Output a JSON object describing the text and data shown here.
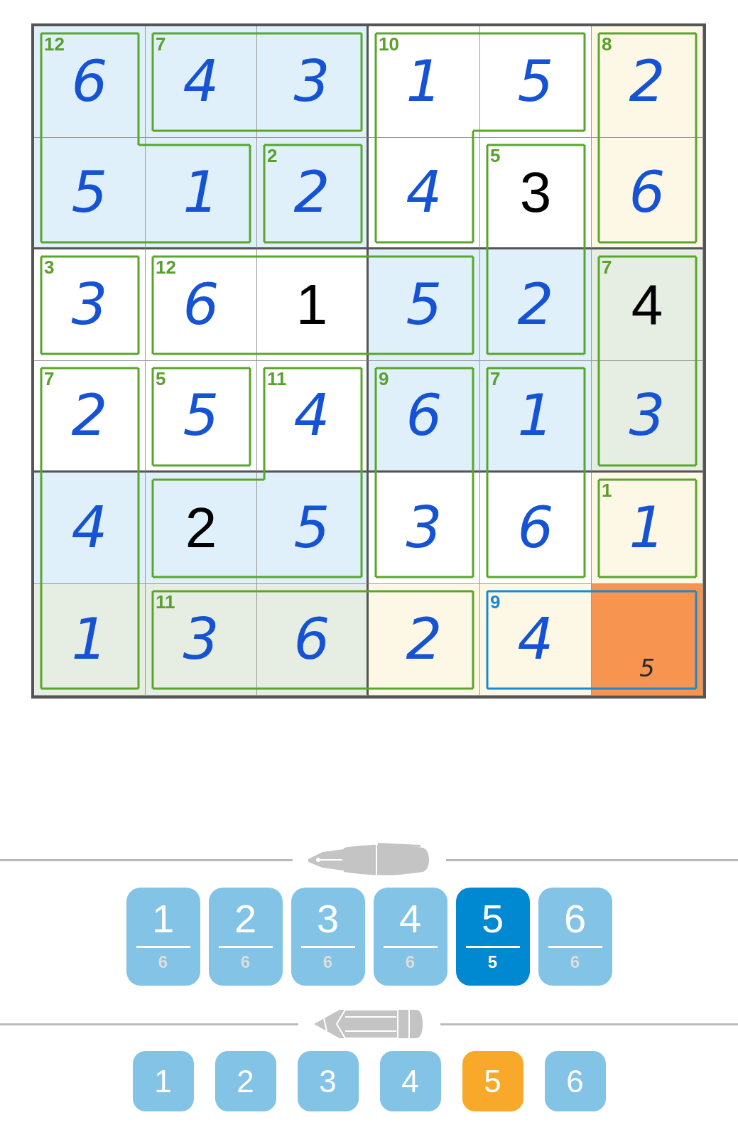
{
  "grid": {
    "cells": [
      {
        "value": "6",
        "kind": "entered",
        "color": "#dff0fb",
        "selected": false,
        "sum": "12",
        "joins_right": false,
        "joins_down": true
      },
      {
        "value": "4",
        "kind": "entered",
        "color": "#dff0fb",
        "selected": false,
        "sum": "7",
        "joins_right": true,
        "joins_down": false
      },
      {
        "value": "3",
        "kind": "entered",
        "color": "#dff0fb",
        "selected": false,
        "joins_right": false,
        "joins_down": false
      },
      {
        "value": "1",
        "kind": "entered",
        "color": "#ffffff",
        "selected": false,
        "sum": "10",
        "joins_right": true,
        "joins_down": true
      },
      {
        "value": "5",
        "kind": "entered",
        "color": "#ffffff",
        "selected": false,
        "joins_right": false,
        "joins_down": false
      },
      {
        "value": "2",
        "kind": "entered",
        "color": "#fdf8e6",
        "selected": false,
        "sum": "8",
        "joins_right": false,
        "joins_down": true
      },
      {
        "value": "5",
        "kind": "entered",
        "color": "#dff0fb",
        "selected": false,
        "joins_right": true,
        "joins_down": false
      },
      {
        "value": "1",
        "kind": "entered",
        "color": "#dff0fb",
        "selected": false,
        "joins_right": false,
        "joins_down": false
      },
      {
        "value": "2",
        "kind": "entered",
        "color": "#dff0fb",
        "selected": false,
        "sum": "2",
        "joins_right": false,
        "joins_down": false
      },
      {
        "value": "4",
        "kind": "entered",
        "color": "#ffffff",
        "selected": false,
        "joins_right": false,
        "joins_down": false
      },
      {
        "value": "3",
        "kind": "given",
        "color": "#ffffff",
        "selected": false,
        "sum": "5",
        "joins_right": false,
        "joins_down": true
      },
      {
        "value": "6",
        "kind": "entered",
        "color": "#fdf8e6",
        "selected": false,
        "joins_right": false,
        "joins_down": false
      },
      {
        "value": "3",
        "kind": "entered",
        "color": "#ffffff",
        "selected": false,
        "sum": "3",
        "joins_right": false,
        "joins_down": false
      },
      {
        "value": "6",
        "kind": "entered",
        "color": "#ffffff",
        "selected": false,
        "sum": "12",
        "joins_right": true,
        "joins_down": false
      },
      {
        "value": "1",
        "kind": "given",
        "color": "#ffffff",
        "selected": false,
        "joins_right": true,
        "joins_down": false
      },
      {
        "value": "5",
        "kind": "entered",
        "color": "#dff0fb",
        "selected": false,
        "joins_right": false,
        "joins_down": false
      },
      {
        "value": "2",
        "kind": "entered",
        "color": "#dff0fb",
        "selected": false,
        "joins_right": false,
        "joins_down": false
      },
      {
        "value": "4",
        "kind": "given",
        "color": "#e6ede3",
        "selected": false,
        "sum": "7",
        "joins_right": false,
        "joins_down": true
      },
      {
        "value": "2",
        "kind": "entered",
        "color": "#ffffff",
        "selected": false,
        "sum": "7",
        "joins_right": false,
        "joins_down": true
      },
      {
        "value": "5",
        "kind": "entered",
        "color": "#ffffff",
        "selected": false,
        "sum": "5",
        "joins_right": false,
        "joins_down": false
      },
      {
        "value": "4",
        "kind": "entered",
        "color": "#ffffff",
        "selected": false,
        "sum": "11",
        "joins_right": false,
        "joins_down": true
      },
      {
        "value": "6",
        "kind": "entered",
        "color": "#dff0fb",
        "selected": false,
        "sum": "9",
        "joins_right": false,
        "joins_down": true
      },
      {
        "value": "1",
        "kind": "entered",
        "color": "#dff0fb",
        "selected": false,
        "sum": "7",
        "joins_right": false,
        "joins_down": true
      },
      {
        "value": "3",
        "kind": "entered",
        "color": "#e6ede3",
        "selected": false,
        "joins_right": false,
        "joins_down": false
      },
      {
        "value": "4",
        "kind": "entered",
        "color": "#dff0fb",
        "selected": false,
        "joins_right": false,
        "joins_down": true
      },
      {
        "value": "2",
        "kind": "given",
        "color": "#dff0fb",
        "selected": false,
        "joins_right": true,
        "joins_down": false
      },
      {
        "value": "5",
        "kind": "entered",
        "color": "#dff0fb",
        "selected": false,
        "joins_right": false,
        "joins_down": false
      },
      {
        "value": "3",
        "kind": "entered",
        "color": "#ffffff",
        "selected": false,
        "joins_right": false,
        "joins_down": false
      },
      {
        "value": "6",
        "kind": "entered",
        "color": "#ffffff",
        "selected": false,
        "joins_right": false,
        "joins_down": false
      },
      {
        "value": "1",
        "kind": "entered",
        "color": "#fdf8e6",
        "selected": false,
        "sum": "1",
        "joins_right": false,
        "joins_down": false
      },
      {
        "value": "1",
        "kind": "entered",
        "color": "#e6ede3",
        "selected": false,
        "joins_right": false,
        "joins_down": false
      },
      {
        "value": "3",
        "kind": "entered",
        "color": "#e6ede3",
        "selected": false,
        "sum": "11",
        "joins_right": true,
        "joins_down": false
      },
      {
        "value": "6",
        "kind": "entered",
        "color": "#e6ede3",
        "selected": false,
        "joins_right": true,
        "joins_down": false
      },
      {
        "value": "2",
        "kind": "entered",
        "color": "#fdf8e6",
        "selected": false,
        "joins_right": false,
        "joins_down": false
      },
      {
        "value": "4",
        "kind": "entered",
        "color": "#fdf8e6",
        "selected": false,
        "sum": "9",
        "joins_right": true,
        "joins_down": false
      },
      {
        "kind": "notes",
        "notes": "5",
        "color": "#f7944f",
        "selected": true,
        "joins_right": false,
        "joins_down": false
      }
    ]
  },
  "pen_pad": {
    "keys": [
      {
        "digit": "1",
        "count": "6",
        "selected": false
      },
      {
        "digit": "2",
        "count": "6",
        "selected": false
      },
      {
        "digit": "3",
        "count": "6",
        "selected": false
      },
      {
        "digit": "4",
        "count": "6",
        "selected": false
      },
      {
        "digit": "5",
        "count": "5",
        "selected": true
      },
      {
        "digit": "6",
        "count": "6",
        "selected": false
      }
    ]
  },
  "pencil_pad": {
    "keys": [
      {
        "digit": "1",
        "selected": false
      },
      {
        "digit": "2",
        "selected": false
      },
      {
        "digit": "3",
        "selected": false
      },
      {
        "digit": "4",
        "selected": false
      },
      {
        "digit": "5",
        "selected": true
      },
      {
        "digit": "6",
        "selected": false
      }
    ]
  }
}
